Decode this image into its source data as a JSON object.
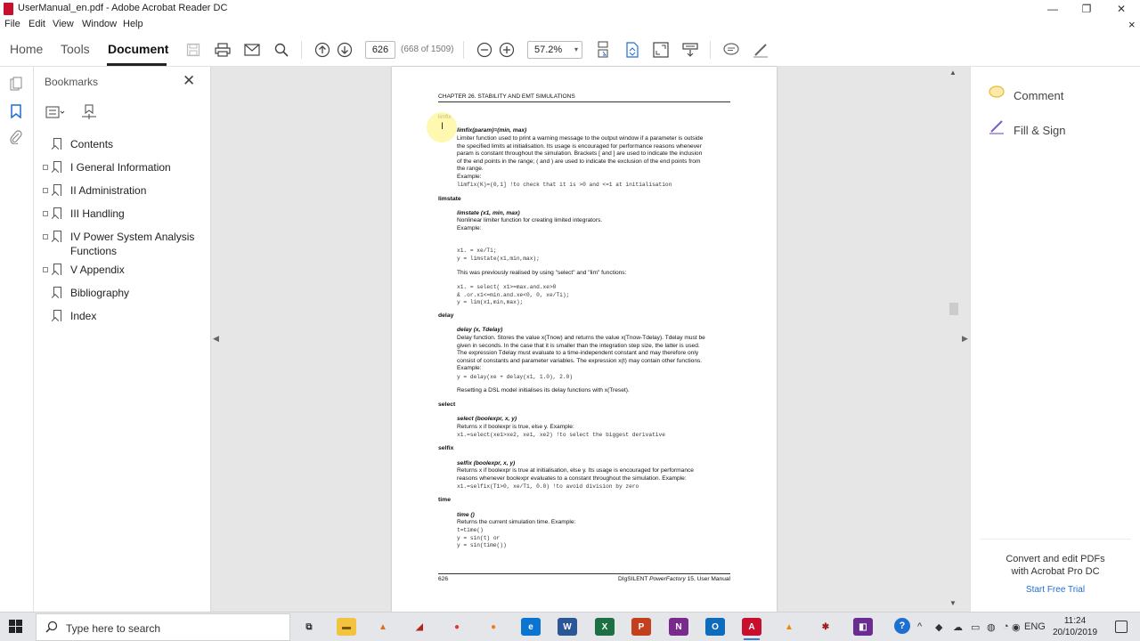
{
  "window": {
    "title": "UserManual_en.pdf - Adobe Acrobat Reader DC",
    "controls": [
      "—",
      "❐",
      "✕"
    ]
  },
  "menu": [
    "File",
    "Edit",
    "View",
    "Window",
    "Help"
  ],
  "menu_close": "×",
  "tabs": {
    "home": "Home",
    "tools": "Tools",
    "document": "Document"
  },
  "toolbar": {
    "page_number": "626",
    "page_count": "(668 of 1509)",
    "zoom": "57.2%",
    "zoom_caret": "▾"
  },
  "bookmarks": {
    "title": "Bookmarks",
    "close": "✕",
    "items": [
      {
        "label": "Contents",
        "expandable": false
      },
      {
        "label": "I General Information",
        "expandable": true
      },
      {
        "label": "II Administration",
        "expandable": true
      },
      {
        "label": "III Handling",
        "expandable": true
      },
      {
        "label": "IV Power System Analysis Functions",
        "expandable": true
      },
      {
        "label": "V Appendix",
        "expandable": true
      },
      {
        "label": "Bibliography",
        "expandable": false
      },
      {
        "label": "Index",
        "expandable": false
      }
    ]
  },
  "pdf": {
    "header": "CHAPTER 26.  STABILITY AND EMT SIMULATIONS",
    "footer_left": "626",
    "footer_right_pre": "DIgSILENT ",
    "footer_right_em": "PowerFactory",
    "footer_right_post": " 15, User Manual",
    "limfix": {
      "name": "limfix",
      "sig": "limfix(param)=(min, max)",
      "desc": [
        "Limiter function used to print a warning message to the output window if a parameter is outside",
        "the specified limits at initialisation.  Its usage is encouraged for performance reasons whenever",
        "param is constant throughout the simulation. Brackets [ and ] are used to indicate the inclusion",
        "of the end points in the range; ( and ) are used to indicate the exclusion of the end points from",
        "the range.",
        "Example:"
      ],
      "code": "limfix(K)=(0,1] !to check that it is >0 and <=1 at initialisation"
    },
    "limstate": {
      "name": "limstate",
      "sig": "limstate (x1, min, max)",
      "desc": [
        "Nonlinear limiter function for creating limited integrators.",
        "Example:"
      ],
      "code": [
        "x1.   = xe/Ti;",
        "y = limstate(x1,min,max);"
      ],
      "note": "This was previously realised by using \"select\" and \"lim\" functions:",
      "code2": [
        "x1.   = select( x1>=max.and.xe>0",
        "& .or.x1<=min.and.xe<0, 0, xe/Ti);",
        "y = lim(x1,min,max);"
      ]
    },
    "delay": {
      "name": "delay",
      "sig": "delay (x, Tdelay)",
      "desc": [
        "Delay function. Stores the value x(Tnow) and returns the value x(Tnow-Tdelay). Tdelay must be",
        "given in seconds.  In the case that it is smaller than the integration step size, the latter is used.",
        "The expression Tdelay must evaluate to a time-independent constant and may therefore only",
        "consist of constants and parameter variables. The expression x(t) may contain other functions.",
        "Example:"
      ],
      "code": "y = delay(xe + delay(x1, 1.0), 2.0)",
      "note": "Resetting a DSL model initialises its delay functions with x(Treset)."
    },
    "select": {
      "name": "select",
      "sig": "select (boolexpr, x, y)",
      "desc": [
        "Returns x if boolexpr is true, else y. Example:"
      ],
      "code": "x1.=select(xe1>xe2, xe1, xe2) !to select the biggest derivative"
    },
    "selfix": {
      "name": "selfix",
      "sig": "selfix (boolexpr, x, y)",
      "desc": [
        "Returns x if boolexpr is true at initialisation, else y.  Its usage is encouraged for performance",
        "reasons whenever boolexpr evaluates to a constant throughout the simulation. Example:"
      ],
      "code": "x1.=selfix(T1>0, xe/T1, 0.0) !to avoid division by zero"
    },
    "time": {
      "name": "time",
      "sig": "time ()",
      "desc": [
        "Returns the current simulation time. Example:"
      ],
      "code": [
        "t=time()",
        "y = sin(t) or",
        "y = sin(time())"
      ]
    }
  },
  "right_pane": {
    "comment": "Comment",
    "fill_sign": "Fill & Sign",
    "promo_line1": "Convert and edit PDFs",
    "promo_line2": "with Acrobat Pro DC",
    "promo_link": "Start Free Trial"
  },
  "taskbar": {
    "search_placeholder": "Type here to search",
    "lang": "ENG",
    "time": "11:24",
    "date": "20/10/2019",
    "apps": [
      {
        "name": "task-view",
        "label": "⧉",
        "color": "#e4e6ea",
        "fg": "#333"
      },
      {
        "name": "file-explorer",
        "label": "▬",
        "color": "#f3c340",
        "fg": "#7a5a00"
      },
      {
        "name": "matlab",
        "label": "▲",
        "color": "#e4e6ea",
        "fg": "#e0701f"
      },
      {
        "name": "app-red",
        "label": "◢",
        "color": "#e4e6ea",
        "fg": "#b0261b"
      },
      {
        "name": "chrome",
        "label": "●",
        "color": "#e4e6ea",
        "fg": "#d93f2b"
      },
      {
        "name": "firefox",
        "label": "●",
        "color": "#e4e6ea",
        "fg": "#f07c1e"
      },
      {
        "name": "edge",
        "label": "e",
        "color": "#0a74d0",
        "fg": "#fff"
      },
      {
        "name": "word",
        "label": "W",
        "color": "#2b5797",
        "fg": "#fff"
      },
      {
        "name": "excel",
        "label": "X",
        "color": "#1d7044",
        "fg": "#fff"
      },
      {
        "name": "powerpoint",
        "label": "P",
        "color": "#c3401e",
        "fg": "#fff"
      },
      {
        "name": "onenote",
        "label": "N",
        "color": "#7a2a8c",
        "fg": "#fff"
      },
      {
        "name": "outlook",
        "label": "O",
        "color": "#0f6cbd",
        "fg": "#fff"
      },
      {
        "name": "acrobat",
        "label": "A",
        "color": "#c8102e",
        "fg": "#fff"
      },
      {
        "name": "vlc",
        "label": "▲",
        "color": "#e4e6ea",
        "fg": "#f08a00"
      },
      {
        "name": "app-bug",
        "label": "✱",
        "color": "#e4e6ea",
        "fg": "#a21d1d"
      },
      {
        "name": "visual-studio",
        "label": "◧",
        "color": "#6a2c91",
        "fg": "#fff"
      }
    ],
    "tray_icons": [
      "?",
      "^",
      "◆",
      "☁",
      "▭",
      "◍",
      "◔",
      "◉"
    ]
  }
}
